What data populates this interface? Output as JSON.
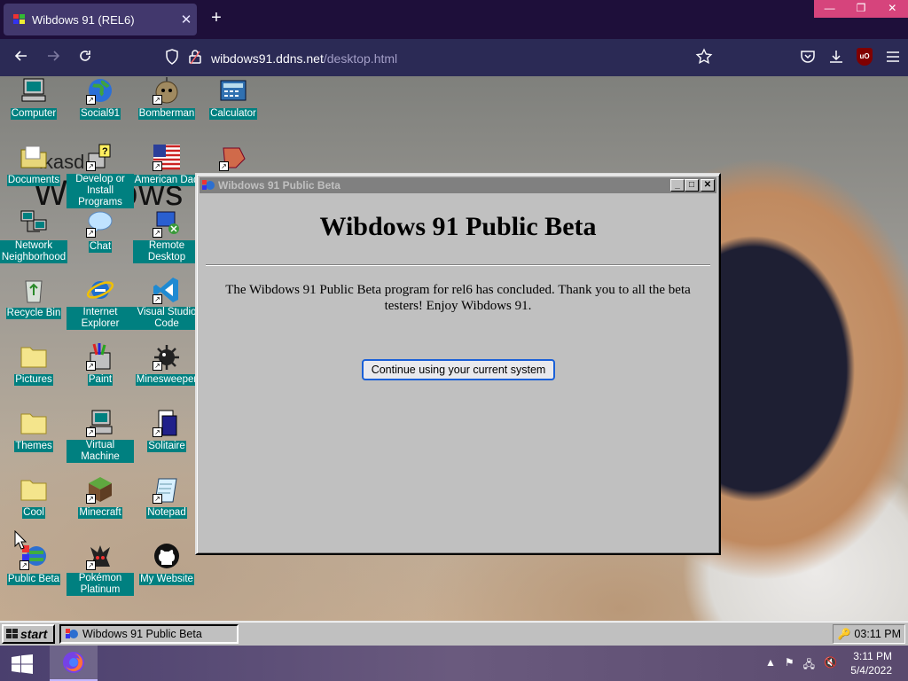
{
  "browser": {
    "tab_title": "Wibdows 91 (REL6)",
    "tab_close": "✕",
    "new_tab": "+",
    "window_controls": [
      "—",
      "❐",
      "✕"
    ],
    "url_host": "wibdows91.ddns.net",
    "url_path": "/desktop.html"
  },
  "desktop": {
    "wallpaper_text": "Wibdows",
    "wallpaper_text_small": "ikasd",
    "icons": [
      {
        "label": "Computer",
        "icon": "computer-icon"
      },
      {
        "label": "Social91",
        "icon": "globe-icon"
      },
      {
        "label": "Bomberman",
        "icon": "bomberman-icon"
      },
      {
        "label": "Calculator",
        "icon": "calculator-icon"
      },
      {
        "label": "Documents",
        "icon": "folder-open-icon"
      },
      {
        "label": "Develop or Install Programs",
        "icon": "install-icon"
      },
      {
        "label": "American Dad",
        "icon": "flag-icon"
      },
      {
        "label": "",
        "icon": "shortcut-icon"
      },
      {
        "label": "Network Neighborhood",
        "icon": "network-icon"
      },
      {
        "label": "Chat",
        "icon": "chat-icon"
      },
      {
        "label": "Remote Desktop",
        "icon": "remote-desktop-icon"
      },
      {
        "label": "Recycle Bin",
        "icon": "recycle-bin-icon"
      },
      {
        "label": "Internet Explorer",
        "icon": "internet-explorer-icon"
      },
      {
        "label": "Visual Studio Code",
        "icon": "vscode-icon"
      },
      {
        "label": "Pictures",
        "icon": "folder-icon"
      },
      {
        "label": "Paint",
        "icon": "paint-icon"
      },
      {
        "label": "Minesweeper",
        "icon": "minesweeper-icon"
      },
      {
        "label": "Themes",
        "icon": "folder-icon"
      },
      {
        "label": "Virtual Machine",
        "icon": "virtual-machine-icon"
      },
      {
        "label": "Solitaire",
        "icon": "solitaire-icon"
      },
      {
        "label": "Cool",
        "icon": "folder-icon"
      },
      {
        "label": "Minecraft",
        "icon": "minecraft-icon"
      },
      {
        "label": "Notepad",
        "icon": "notepad-icon"
      },
      {
        "label": "Public Beta",
        "icon": "public-beta-icon"
      },
      {
        "label": "Pokémon Platinum",
        "icon": "pokemon-icon"
      },
      {
        "label": "My Website",
        "icon": "github-icon"
      }
    ]
  },
  "dialog": {
    "title": "Wibdows 91 Public Beta",
    "heading": "Wibdows 91 Public Beta",
    "message": "The Wibdows 91 Public Beta program for rel6 has concluded. Thank you to all the beta testers! Enjoy Wibdows 91.",
    "continue_label": "Continue using your current system",
    "buttons": [
      "_",
      "□",
      "✕"
    ]
  },
  "w9_taskbar": {
    "start_label": "start",
    "task_label": "Wibdows 91 Public Beta",
    "clock": "03:11 PM"
  },
  "host_taskbar": {
    "time": "3:11 PM",
    "date": "5/4/2022"
  }
}
